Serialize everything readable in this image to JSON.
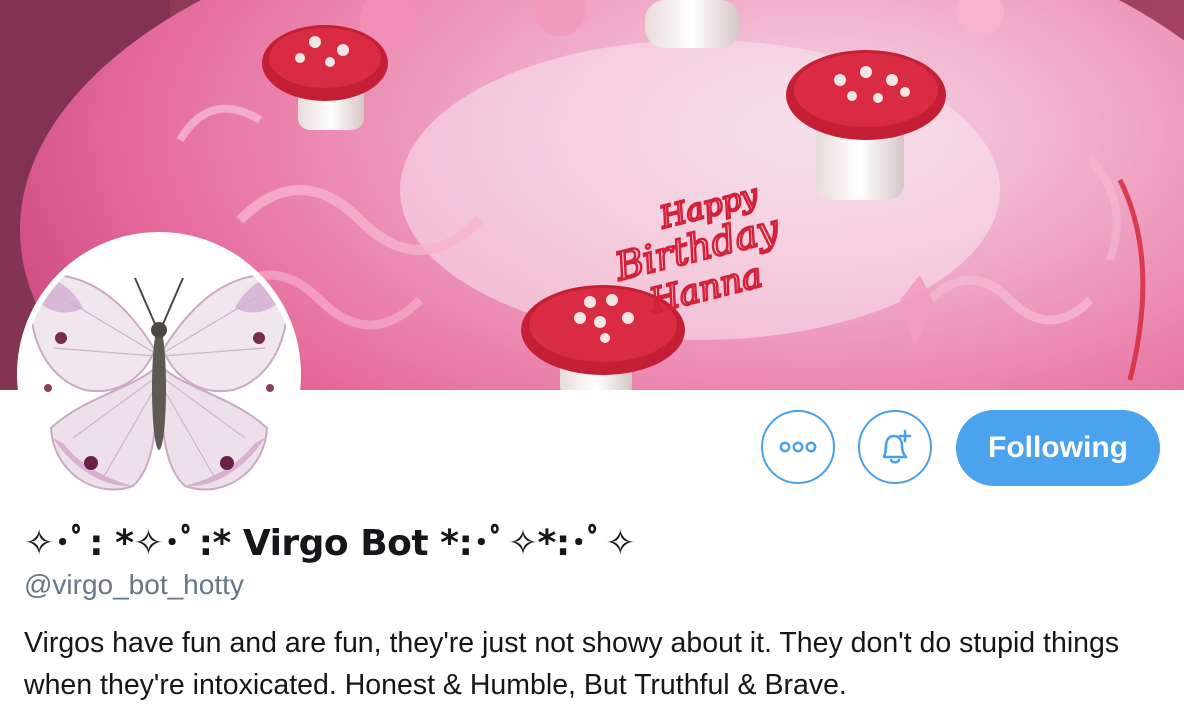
{
  "profile": {
    "display_name": "✧･ﾟ: *✧･ﾟ:* Virgo Bot *:･ﾟ✧*:･ﾟ✧",
    "handle": "@virgo_bot_hotty",
    "bio": "Virgos have fun and are fun, they're just not showy about it. They don't do stupid things when they're intoxicated. Honest & Humble, But Truthful & Brave."
  },
  "banner": {
    "cake_text_line1": "Happy",
    "cake_text_line2": "Birthday",
    "cake_text_line3": "Hanna"
  },
  "actions": {
    "follow_label": "Following",
    "more_icon": "more-dots-icon",
    "notify_icon": "bell-plus-icon"
  },
  "colors": {
    "accent": "#4aa3ec",
    "accent_border": "#4aa0e8",
    "text_primary": "#14171a",
    "text_secondary": "#657786",
    "banner_pink": "#e87aa6"
  }
}
